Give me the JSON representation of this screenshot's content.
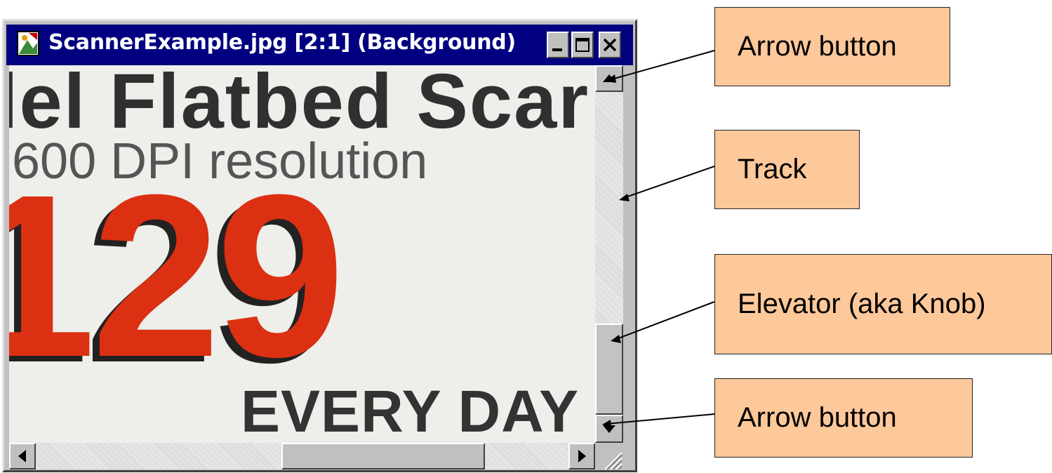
{
  "window": {
    "title": "ScannerExample.jpg [2:1] (Background)",
    "controls": {
      "minimize": "minimize",
      "maximize": "maximize",
      "close": "close"
    }
  },
  "document": {
    "line1": "lel Flatbed Scar",
    "line2": "600 DPI resolution",
    "price": "129",
    "line4": "EVERY DAY"
  },
  "callouts": {
    "arrow_top": "Arrow button",
    "track": "Track",
    "elevator": "Elevator (aka Knob)",
    "arrow_bottom": "Arrow button"
  },
  "colors": {
    "titlebar": "#000080",
    "callout_fill": "#fdc89a",
    "price_red": "#dc3012"
  },
  "icons": [
    "app-icon",
    "minimize-icon",
    "maximize-icon",
    "close-icon",
    "up-arrow-icon",
    "down-arrow-icon",
    "left-arrow-icon",
    "right-arrow-icon",
    "resize-grip-icon"
  ]
}
